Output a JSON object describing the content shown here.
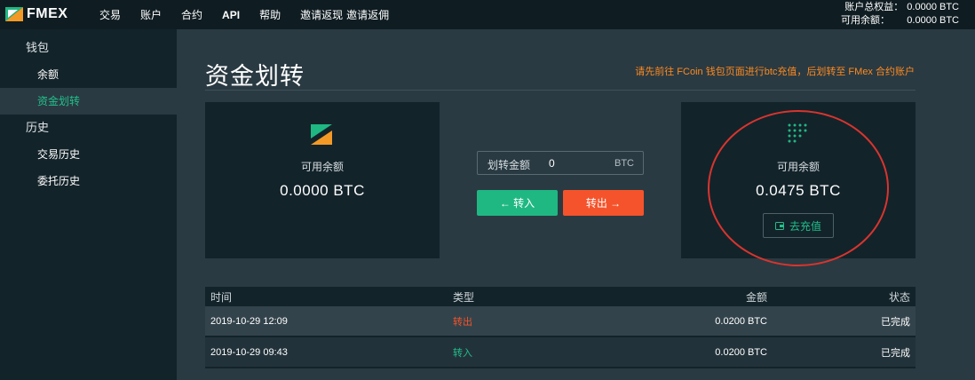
{
  "header": {
    "logo_text": "FMEX",
    "nav": [
      "交易",
      "账户",
      "合约",
      "API",
      "帮助",
      "邀请返现",
      "邀请返佣"
    ],
    "account": {
      "equity_label": "账户总权益：",
      "equity_value": "0.0000 BTC",
      "available_label": "可用余额：",
      "available_value": "0.0000 BTC"
    }
  },
  "sidebar": {
    "groups": [
      {
        "label": "钱包",
        "items": [
          "余额",
          "资金划转"
        ]
      },
      {
        "label": "历史",
        "items": [
          "交易历史",
          "委托历史"
        ]
      }
    ],
    "active_item": "资金划转"
  },
  "main": {
    "title": "资金划转",
    "notice": "请先前往 FCoin 钱包页面进行btc充值，后划转至 FMex 合约账户",
    "left_card": {
      "label": "可用余额",
      "value": "0.0000 BTC"
    },
    "right_card": {
      "label": "可用余额",
      "value": "0.0475 BTC",
      "recharge_label": "去充值"
    },
    "transfer": {
      "label": "划转金额",
      "value": "0",
      "unit": "BTC",
      "in_label": "← 转入",
      "out_label": "转出 →"
    }
  },
  "table": {
    "headers": [
      "时间",
      "类型",
      "金额",
      "状态"
    ],
    "rows": [
      {
        "time": "2019-10-29 12:09",
        "type": "转出",
        "amount": "0.0200 BTC",
        "status": "已完成"
      },
      {
        "time": "2019-10-29 09:43",
        "type": "转入",
        "amount": "0.0200 BTC",
        "status": "已完成"
      }
    ]
  },
  "colors": {
    "accent_green": "#21c08b",
    "accent_orange": "#f5532b",
    "notice_orange": "#ff8a1f",
    "annotation_red": "#d9342e"
  },
  "icons": [
    "fmex-logo-icon",
    "fcoin-logo-icon",
    "fmex-dots-icon",
    "wallet-icon",
    "arrow-left-icon",
    "arrow-right-icon"
  ]
}
